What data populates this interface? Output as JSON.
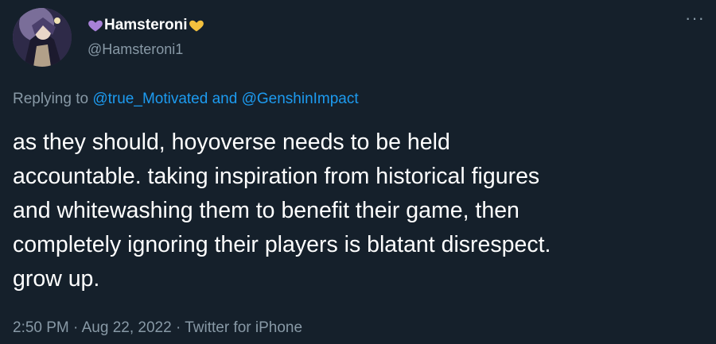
{
  "user": {
    "display_name": "Hamsteroni",
    "handle": "@Hamsteroni1",
    "name_prefix_icon": "purple-heart-icon",
    "name_suffix_icon": "yellow-heart-icon"
  },
  "menu": {
    "more_icon": "more-horizontal-icon"
  },
  "reply": {
    "prefix": "Replying to",
    "mention_1": "@true_Motivated",
    "conjunction": "and",
    "mention_2": "@GenshinImpact"
  },
  "tweet": {
    "lines": [
      "as they should, hoyoverse needs to be held",
      "accountable. taking inspiration from historical figures",
      "and whitewashing them to benefit their game, then",
      "completely ignoring their players is blatant disrespect.",
      "grow up."
    ]
  },
  "meta": {
    "time": "2:50 PM",
    "separator": "·",
    "date": "Aug 22, 2022",
    "source": "Twitter for iPhone"
  },
  "colors": {
    "background": "#15202b",
    "secondary_text": "#8899a6",
    "link": "#1d9bf0",
    "purple_heart": "#a881d8",
    "yellow_heart": "#f4c13e"
  }
}
